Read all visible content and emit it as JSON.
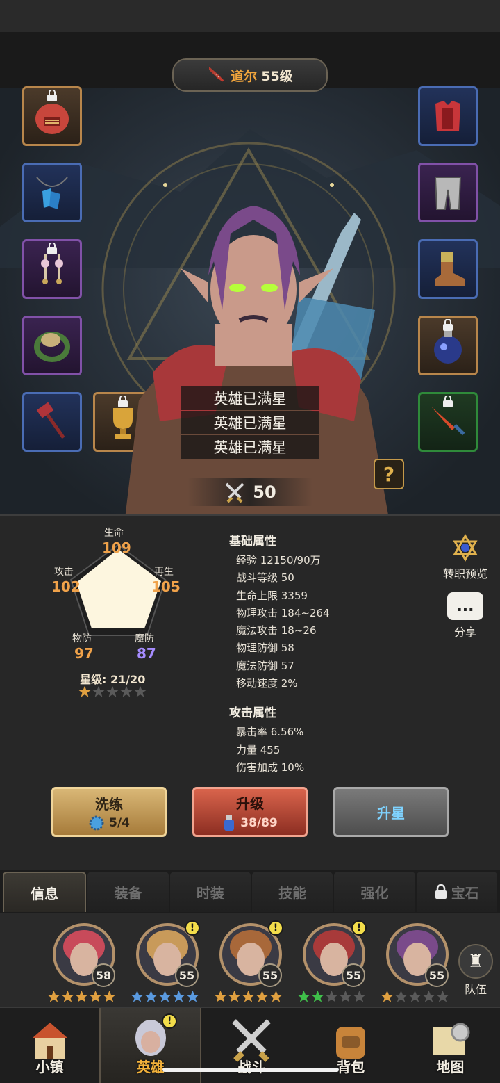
{
  "hero": {
    "name": "道尔",
    "level": "55级",
    "max_star_lines": [
      "英雄已满星",
      "英雄已满星",
      "英雄已满星"
    ],
    "power": "50",
    "help": "?"
  },
  "equipment": {
    "left": [
      "helmet-icon",
      "necklace-icon",
      "earrings-icon",
      "ring-icon",
      "hammer-icon",
      "trophy-icon"
    ],
    "right": [
      "armor-icon",
      "pants-icon",
      "boots-icon",
      "potion-icon",
      "dagger-icon"
    ]
  },
  "radar": {
    "hp_label": "生命",
    "hp": "109",
    "regen_label": "再生",
    "regen": "105",
    "atk_label": "攻击",
    "atk": "102",
    "pdef_label": "物防",
    "pdef": "97",
    "mdef_label": "魔防",
    "mdef": "87"
  },
  "star_level": "星级: 21/20",
  "base_attrs": {
    "title": "基础属性",
    "rows": [
      "经验 12150/90万",
      "战斗等级 50",
      "生命上限 3359",
      "物理攻击 184~264",
      "魔法攻击 18~26",
      "物理防御 58",
      "魔法防御 57",
      "移动速度 2%"
    ]
  },
  "attack_attrs": {
    "title": "攻击属性",
    "rows": [
      "暴击率 6.56%",
      "力量 455",
      "伤害加成 10%"
    ]
  },
  "side": {
    "job_preview": "转职预览",
    "share": "分享",
    "share_glyph": "..."
  },
  "actions": {
    "wash": {
      "label": "洗练",
      "count": "5/4"
    },
    "upgrade": {
      "label": "升级",
      "count": "38/89"
    },
    "star_up": {
      "label": "升星"
    }
  },
  "tabs": [
    "信息",
    "装备",
    "时装",
    "技能",
    "强化",
    "宝石"
  ],
  "roster": [
    {
      "level": "58",
      "stars": 5,
      "star_color": "#e0a040",
      "alert": false
    },
    {
      "level": "55",
      "stars": 5,
      "star_color": "#5a9ae0",
      "alert": true
    },
    {
      "level": "55",
      "stars": 5,
      "star_color": "#e0a040",
      "alert": true
    },
    {
      "level": "55",
      "stars": 2,
      "star_color": "#3fbf4a",
      "alert": true
    },
    {
      "level": "55",
      "stars": 1,
      "star_color": "#e0a040",
      "alert": false
    }
  ],
  "team_label": "队伍",
  "nav": [
    "小镇",
    "英雄",
    "战斗",
    "背包",
    "地图"
  ],
  "colors": {
    "accent": "#f2a53c",
    "purple": "#a68cff",
    "active_tab": "#f3efe6"
  }
}
